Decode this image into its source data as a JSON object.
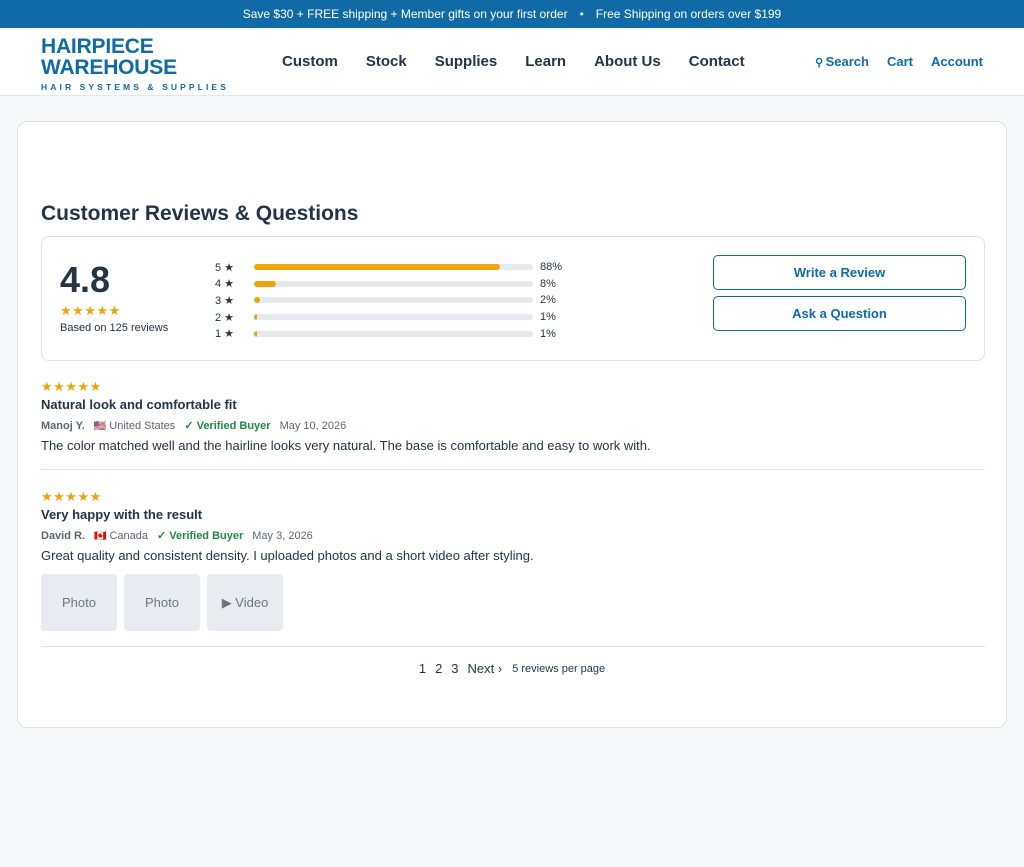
{
  "promo": {
    "left": "Save $30 + FREE shipping + Member gifts on your first order",
    "sep": "•",
    "right": "Free Shipping on orders over $199"
  },
  "logo": {
    "line1": "HAIRPIECE",
    "line2": "WAREHOUSE",
    "tagline": "HAIR SYSTEMS & SUPPLIES"
  },
  "nav": [
    "Custom",
    "Stock",
    "Supplies",
    "Learn",
    "About Us",
    "Contact"
  ],
  "util": {
    "search": "Search",
    "cart": "Cart",
    "account": "Account"
  },
  "reviews_section": {
    "title": "Customer Reviews & Questions",
    "average": "4.8",
    "average_stars": "★★★★★",
    "based_on": "Based on 125 reviews",
    "distribution": [
      {
        "label": "5 ★",
        "pct": 88,
        "pct_text": "88%"
      },
      {
        "label": "4 ★",
        "pct": 8,
        "pct_text": "8%"
      },
      {
        "label": "3 ★",
        "pct": 2,
        "pct_text": "2%"
      },
      {
        "label": "2 ★",
        "pct": 1,
        "pct_text": "1%"
      },
      {
        "label": "1 ★",
        "pct": 1,
        "pct_text": "1%"
      }
    ],
    "write_button": "Write a Review",
    "ask_button": "Ask a Question"
  },
  "reviews": [
    {
      "stars": "★★★★★",
      "title": "Natural look and comfortable fit",
      "author": "Manoj Y.",
      "flag": "🇺🇸",
      "country": "United States",
      "verified": "✓ Verified Buyer",
      "date": "May 10, 2026",
      "body": "The color matched well and the hairline looks very natural. The base is comfortable and easy to work with."
    },
    {
      "stars": "★★★★★",
      "title": "Very happy with the result",
      "author": "David R.",
      "flag": "🇨🇦",
      "country": "Canada",
      "verified": "✓ Verified Buyer",
      "date": "May 3, 2026",
      "body": "Great quality and consistent density. I uploaded photos and a short video after styling.",
      "media": [
        "Photo",
        "Photo",
        "▶ Video"
      ]
    }
  ],
  "pagination": {
    "pages": [
      "1",
      "2",
      "3"
    ],
    "next": "Next ›",
    "per_page": "5 reviews per page"
  },
  "colors": {
    "brand": "#0f6aa6",
    "star": "#f0a30a",
    "verified": "#1e8a45",
    "text": "#243447"
  }
}
